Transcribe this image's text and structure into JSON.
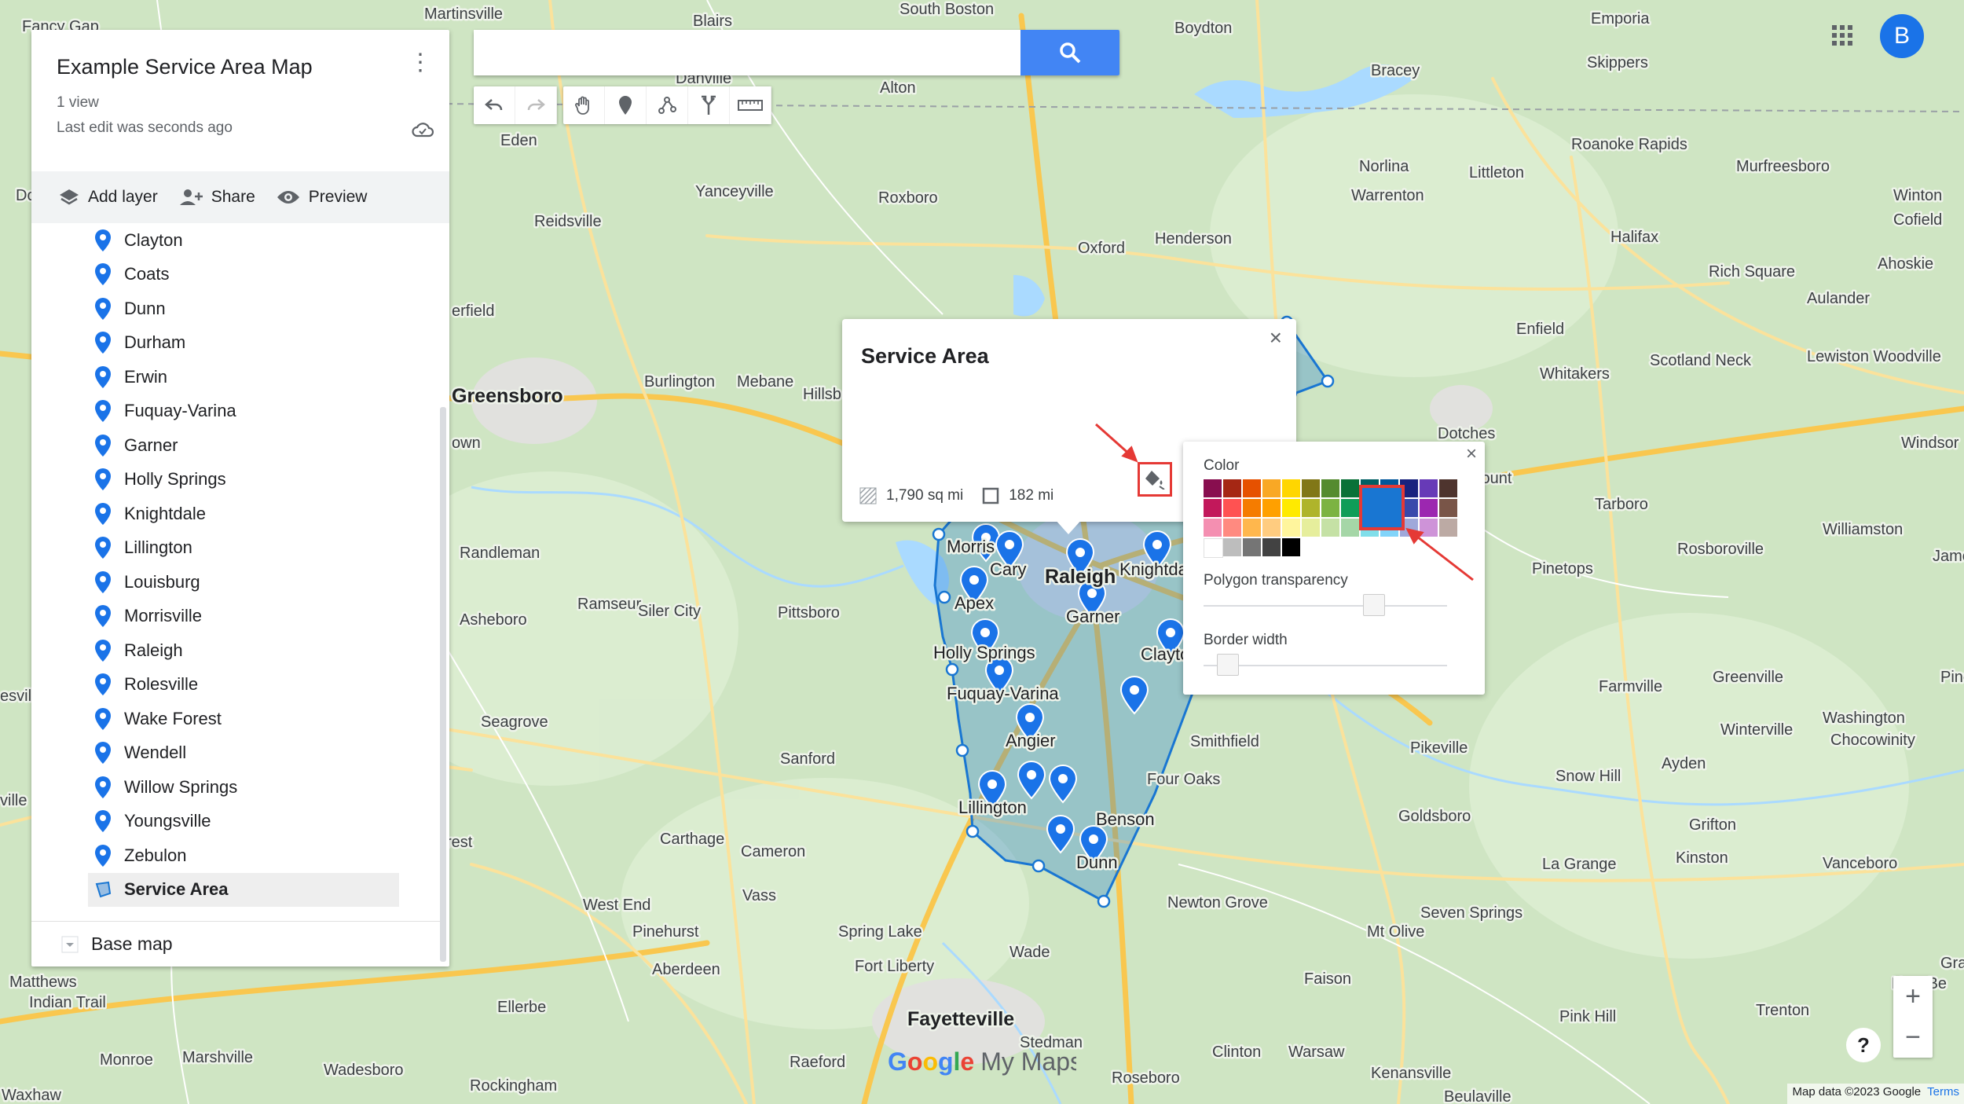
{
  "panel": {
    "title": "Example Service Area Map",
    "views": "1 view",
    "last_edit": "Last edit was seconds ago",
    "actions": {
      "add_layer": "Add layer",
      "share": "Share",
      "preview": "Preview"
    },
    "items": [
      "Clayton",
      "Coats",
      "Dunn",
      "Durham",
      "Erwin",
      "Fuquay-Varina",
      "Garner",
      "Holly Springs",
      "Knightdale",
      "Lillington",
      "Louisburg",
      "Morrisville",
      "Raleigh",
      "Rolesville",
      "Wake Forest",
      "Wendell",
      "Willow Springs",
      "Youngsville",
      "Zebulon"
    ],
    "selected_item": "Service Area",
    "base_map": "Base map"
  },
  "search": {
    "value": "",
    "placeholder": ""
  },
  "avatar": {
    "initial": "B"
  },
  "info_window": {
    "title": "Service Area",
    "area": "1,790 sq mi",
    "perimeter": "182 mi"
  },
  "picker": {
    "color_label": "Color",
    "transparency_label": "Polygon transparency",
    "border_label": "Border width",
    "transparency_value": 0.7,
    "border_value": 0.1,
    "selected_color": "#1976d2",
    "rows": [
      [
        "#880e4f",
        "#a52714",
        "#e65100",
        "#f9a825",
        "#ffd600",
        "#817717",
        "#558b2f",
        "#097138",
        "#006064",
        "#01579b",
        "#1a237e",
        "#673ab7",
        "#4e342e"
      ],
      [
        "#c2185b",
        "#ff5252",
        "#f57c00",
        "#ffa000",
        "#ffea00",
        "#afb42b",
        "#7cb342",
        "#0f9d58",
        "#0097a7",
        "#0288d1",
        "#3949ab",
        "#9c27b0",
        "#795548"
      ],
      [
        "#f48fb1",
        "#ff8a80",
        "#ffb74d",
        "#ffcc80",
        "#fff59d",
        "#e6ee9c",
        "#c5e1a5",
        "#a5d6a7",
        "#80deea",
        "#81d4fa",
        "#9fa8da",
        "#ce93d8",
        "#bcaaa4"
      ],
      [
        "#ffffff",
        "#bdbdbd",
        "#757575",
        "#424242",
        "#000000"
      ]
    ]
  },
  "map_labels": {
    "cities_big": [
      "Greensboro",
      "Raleigh",
      "Fayetteville"
    ],
    "towns": [
      "Martinsville",
      "Blairs",
      "South Boston",
      "Boydton",
      "Emporia",
      "Skippers",
      "Eden",
      "Danville",
      "Alton",
      "Bracey",
      "Reidsville",
      "Yanceyville",
      "Roxboro",
      "Norlina",
      "Littleton",
      "Roanoke Rapids",
      "Murfreesboro",
      "Winton",
      "Warrenton",
      "Henderson",
      "Oxford",
      "Halifax",
      "Cofield",
      "Rich Square",
      "Ahoskie",
      "Aulander",
      "Burlington",
      "Mebane",
      "Hillsb",
      "Enfield",
      "Scotland Neck",
      "Whitakers",
      "Lewiston Woodville",
      "Dotches",
      "Windsor",
      "Randleman",
      "Asheboro",
      "Ramseur",
      "Siler City",
      "Pittsboro",
      "Tarboro",
      "Williamston",
      "Jamesv",
      "Pinetops",
      "Rosboroville",
      "Morris",
      "Cary",
      "Knightda",
      "Apex",
      "Garner",
      "Holly Springs",
      "Clayto",
      "Fuquay-Varina",
      "Angier",
      "Lillington",
      "Benson",
      "Dunn",
      "Four Oaks",
      "Smithfield",
      "Seagrove",
      "Sanford",
      "Farmville",
      "Greenville",
      "Winterville",
      "Washington",
      "Chocowinity",
      "Ayden",
      "Pikeville",
      "Snow Hill",
      "Goldsboro",
      "Grifton",
      "La Grange",
      "Kinston",
      "Vanceboro",
      "Carthage",
      "Cameron",
      "Vass",
      "West End",
      "Pinehurst",
      "Spring Lake",
      "Newton Grove",
      "Mt Olive",
      "Seven Springs",
      "Aberdeen",
      "Fort Liberty",
      "Wade",
      "Faison",
      "Trenton",
      "Pink Hill",
      "Ellerbe",
      "Stedman",
      "Clinton",
      "Warsaw",
      "Kenansville",
      "New Be",
      "Marshville",
      "Monroe",
      "Wadesboro",
      "Rockingham",
      "Raeford",
      "Roseboro",
      "Beulaville",
      "Matthews",
      "Indian Trail",
      "Waxhaw",
      "Fancy Gap",
      "Do",
      "erfield",
      "own",
      "ville",
      "esvil",
      "Gran",
      "Pine",
      "Sy Mount",
      "Eden",
      "rest"
    ],
    "logo": "Google My Maps",
    "footer_data": "Map data ©2023 Google",
    "footer_terms": "Terms"
  }
}
